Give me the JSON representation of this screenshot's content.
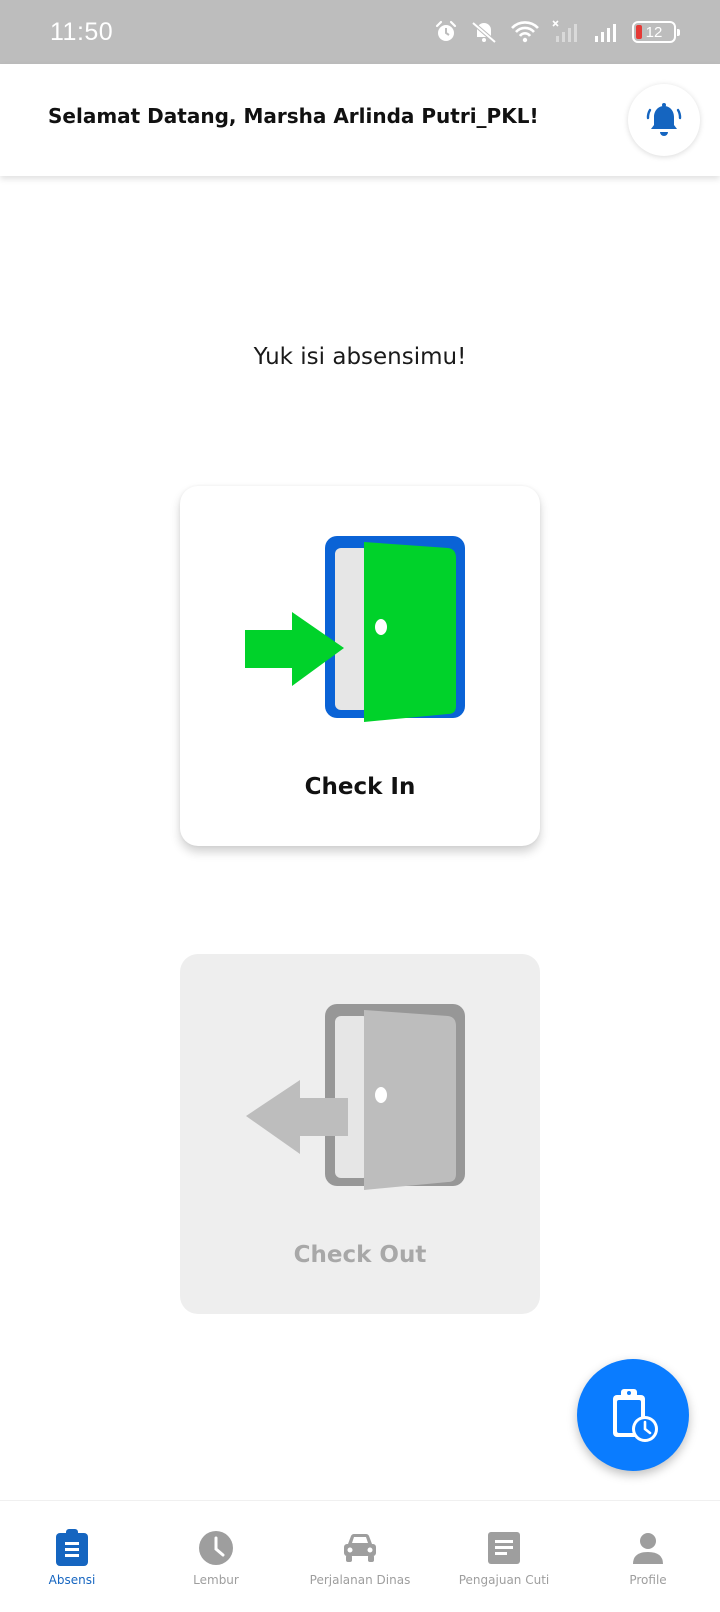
{
  "status_bar": {
    "time": "11:50",
    "battery_level": "12",
    "icons": [
      "alarm-icon",
      "mute-icon",
      "wifi-icon",
      "signal-off-icon",
      "signal-icon",
      "battery-icon"
    ]
  },
  "header": {
    "welcome_text": "Selamat Datang, Marsha Arlinda Putri_PKL!",
    "notification_icon": "bell-icon"
  },
  "main": {
    "prompt": "Yuk isi absensimu!",
    "check_in": {
      "label": "Check In",
      "icon": "door-enter-icon",
      "enabled": true
    },
    "check_out": {
      "label": "Check Out",
      "icon": "door-exit-icon",
      "enabled": false
    }
  },
  "fab": {
    "icon": "clipboard-clock-icon"
  },
  "bottom_nav": {
    "items": [
      {
        "label": "Absensi",
        "icon": "clipboard-list-icon",
        "active": true
      },
      {
        "label": "Lembur",
        "icon": "clock-icon",
        "active": false
      },
      {
        "label": "Perjalanan Dinas",
        "icon": "car-icon",
        "active": false
      },
      {
        "label": "Pengajuan Cuti",
        "icon": "document-icon",
        "active": false
      },
      {
        "label": "Profile",
        "icon": "person-icon",
        "active": false
      }
    ]
  },
  "colors": {
    "primary": "#1565c0",
    "fab": "#0a7cff",
    "check_in_green": "#00d22a",
    "door_frame_blue": "#0a63d6",
    "inactive": "#9e9e9e"
  }
}
